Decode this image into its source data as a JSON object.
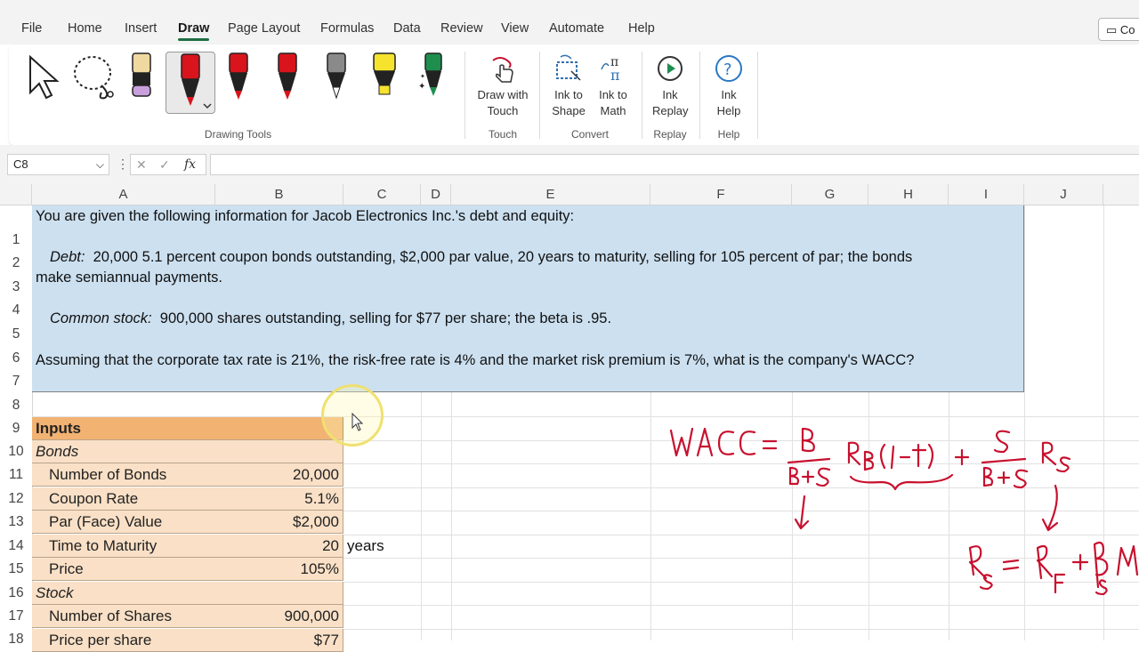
{
  "menubar": {
    "items": [
      "File",
      "Home",
      "Insert",
      "Draw",
      "Page Layout",
      "Formulas",
      "Data",
      "Review",
      "View",
      "Automate",
      "Help"
    ],
    "active": "Draw",
    "comments_button": "Co"
  },
  "ribbon": {
    "drawing_tools_label": "Drawing Tools",
    "touch": {
      "button": "Draw with Touch",
      "group": "Touch"
    },
    "convert": {
      "ink_to_shape": "Ink to Shape",
      "ink_to_math": "Ink to Math",
      "group": "Convert"
    },
    "replay": {
      "button": "Ink Replay",
      "group": "Replay"
    },
    "help": {
      "button": "Ink Help",
      "group": "Help"
    },
    "pen_colors": [
      "#d9141c",
      "#d9141c",
      "#d9141c",
      "#8a8a8a",
      "#f5e32e",
      "#1e8e4e"
    ]
  },
  "formula_bar": {
    "name_box": "C8",
    "fx": "fx",
    "formula": ""
  },
  "columns": [
    "A",
    "B",
    "C",
    "D",
    "E",
    "F",
    "G",
    "H",
    "I",
    "J"
  ],
  "rows": [
    "1",
    "2",
    "3",
    "4",
    "5",
    "6",
    "7",
    "8",
    "9",
    "10",
    "11",
    "12",
    "13",
    "14",
    "15",
    "16",
    "17",
    "18"
  ],
  "problem": {
    "intro": "You are given the following information for Jacob Electronics Inc.'s debt and equity:",
    "debt_label": "Debt:",
    "debt_text": "20,000 5.1 percent coupon bonds outstanding, $2,000 par value, 20 years to maturity, selling for 105 percent of par; the bonds",
    "debt_text2": "make semiannual payments.",
    "stock_label": "Common stock:",
    "stock_text": "900,000 shares outstanding, selling for $77 per share; the beta is .95.",
    "question": "Assuming that the corporate tax rate is 21%, the risk-free rate is 4% and the market risk premium is 7%, what is the company's WACC?"
  },
  "inputs": {
    "title": "Inputs",
    "bonds_label": "Bonds",
    "number_of_bonds": {
      "label": "Number of Bonds",
      "value": "20,000"
    },
    "coupon_rate": {
      "label": "Coupon Rate",
      "value": "5.1%"
    },
    "par_value": {
      "label": "Par (Face) Value",
      "value": "$2,000"
    },
    "time_to_maturity": {
      "label": "Time to Maturity",
      "value": "20",
      "unit": "years"
    },
    "price": {
      "label": "Price",
      "value": "105%"
    },
    "stock_label": "Stock",
    "number_of_shares": {
      "label": "Number of Shares",
      "value": "900,000"
    },
    "price_per_share": {
      "label": "Price per share",
      "value": "$77"
    }
  },
  "ink_annotation": {
    "text": "WACC = B/(B+S) R_B(1-t) + S/(B+S) R_S ; R_S = R_F + β_S M...",
    "color": "#c8102e"
  }
}
